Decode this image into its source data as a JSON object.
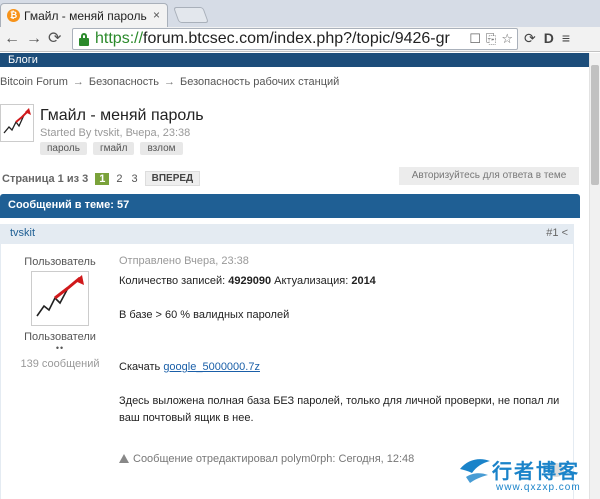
{
  "browser": {
    "tab_title": "Гмайл - меняй пароль",
    "tab_close": "×",
    "favicon_glyph": "₿",
    "url_scheme": "https://",
    "url_rest": "forum.btcsec.com/index.php?/topic/9426-gr",
    "nav": {
      "back": "←",
      "forward": "→",
      "reload": "⟳"
    },
    "omni_icons": [
      "☐",
      "⎘",
      "☆"
    ],
    "ext_icons": [
      "⟳",
      "D",
      "≡"
    ]
  },
  "forum_nav": {
    "blogs": "Блоги"
  },
  "breadcrumb": {
    "items": [
      "Bitcoin Forum",
      "Безопасность",
      "Безопасность рабочих станций"
    ],
    "sep": "→"
  },
  "topic": {
    "title": "Гмайл - меняй пароль",
    "started_by": "Started By tvskit, Вчера, 23:38",
    "tags": [
      "пароль",
      "гмайл",
      "взлом"
    ]
  },
  "pagination": {
    "info": "Страница 1 из 3",
    "current": "1",
    "pages": [
      "2",
      "3"
    ],
    "next": "ВПЕРЕД",
    "reply_hint": "Авторизуйтесь для ответа в теме"
  },
  "post_count": "Сообщений в теме: 57",
  "post": {
    "author": "tvskit",
    "number": "#1 <",
    "role_top": "Пользователь",
    "role_bottom": "Пользователи",
    "dots": "••",
    "posts_count": "139 сообщений",
    "date": "Отправлено Вчера, 23:38",
    "line1_label": "Количество записей: ",
    "line1_count": "4929090",
    "line1_mid": " Актуализация: ",
    "line1_year": "2014",
    "line2": "В базе  > 60 % валидных паролей",
    "download_label": "Скачать ",
    "download_link": "google_5000000.7z",
    "line3a": "Здесь выложена полная база БЕЗ паролей, только для личной проверки, не попал ли",
    "line3b": "ваш почтовый ящик в нее.",
    "edit_note": "Сообщение отредактировал polym0rph: Сегодня, 12:48"
  },
  "watermark": {
    "main": "行者博客",
    "sub": "www.qxzxp.com"
  },
  "colors": {
    "accent": "#1f5f94",
    "page_current": "#7aa23a",
    "url_green": "#2b8a2b",
    "watermark": "#1a83c9"
  }
}
